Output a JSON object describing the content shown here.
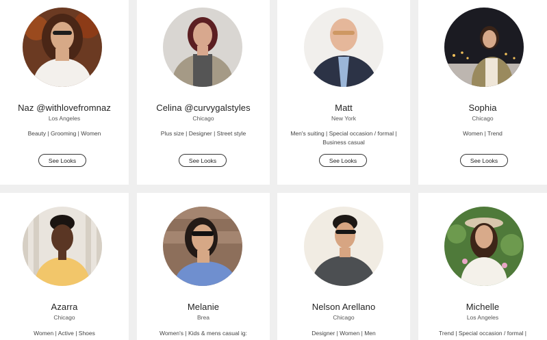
{
  "button_label": "See Looks",
  "stylists": [
    {
      "name": "Naz @withlovefromnaz",
      "city": "Los Angeles",
      "tags": "Beauty | Grooming | Women"
    },
    {
      "name": "Celina @curvygalstyles",
      "city": "Chicago",
      "tags": "Plus size | Designer | Street style"
    },
    {
      "name": "Matt",
      "city": "New York",
      "tags": "Men's suiting | Special occasion / formal | Business casual"
    },
    {
      "name": "Sophia",
      "city": "Chicago",
      "tags": "Women | Trend"
    },
    {
      "name": "Azarra",
      "city": "Chicago",
      "tags": "Women | Active | Shoes"
    },
    {
      "name": "Melanie",
      "city": "Brea",
      "tags": "Women's | Kids & mens casual ig:"
    },
    {
      "name": "Nelson Arellano",
      "city": "Chicago",
      "tags": "Designer | Women | Men"
    },
    {
      "name": "Michelle",
      "city": "Los Angeles",
      "tags": "Trend | Special occasion / formal | Designer"
    }
  ]
}
